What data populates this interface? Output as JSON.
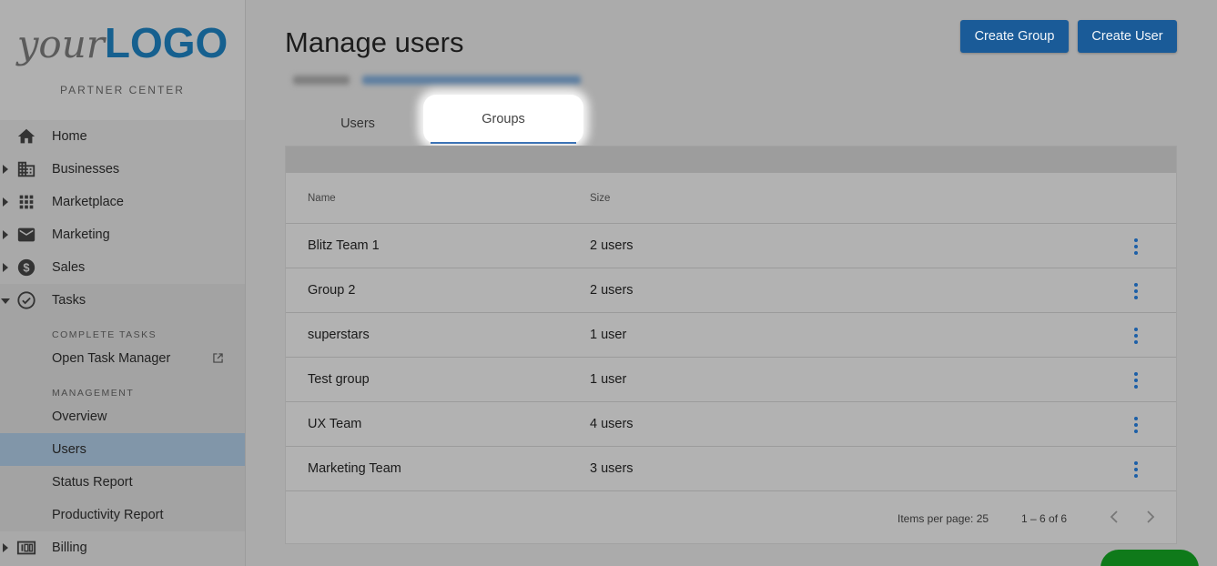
{
  "sidebar": {
    "logo_your": "your",
    "logo_logo": "LOGO",
    "partner_label": "PARTNER CENTER",
    "items": [
      {
        "label": "Home",
        "icon": "home-icon"
      },
      {
        "label": "Businesses",
        "icon": "building-icon"
      },
      {
        "label": "Marketplace",
        "icon": "apps-grid-icon"
      },
      {
        "label": "Marketing",
        "icon": "mail-icon"
      },
      {
        "label": "Sales",
        "icon": "dollar-icon"
      },
      {
        "label": "Tasks",
        "icon": "check-circle-icon"
      }
    ],
    "tasks": {
      "section_complete": "COMPLETE TASKS",
      "open_task_manager": "Open Task Manager",
      "section_management": "MANAGEMENT",
      "overview": "Overview",
      "users": "Users",
      "status_report": "Status Report",
      "productivity_report": "Productivity Report"
    },
    "billing": "Billing"
  },
  "main": {
    "title": "Manage users",
    "buttons": {
      "create_group": "Create Group",
      "create_user": "Create User"
    },
    "tabs": {
      "users": "Users",
      "groups": "Groups"
    },
    "table": {
      "columns": {
        "name": "Name",
        "size": "Size"
      },
      "rows": [
        {
          "name": "Blitz Team 1",
          "size": "2 users"
        },
        {
          "name": "Group 2",
          "size": "2 users"
        },
        {
          "name": "superstars",
          "size": "1 user"
        },
        {
          "name": "Test group",
          "size": "1 user"
        },
        {
          "name": "UX Team",
          "size": "4 users"
        },
        {
          "name": "Marketing Team",
          "size": "3 users"
        }
      ]
    },
    "pager": {
      "items_per_page": "Items per page: 25",
      "range": "1 – 6 of 6"
    }
  },
  "colors": {
    "accent": "#1a5b98",
    "active_nav": "#8196a9",
    "overlay": "#ababab",
    "fab": "#0f7a1a"
  }
}
